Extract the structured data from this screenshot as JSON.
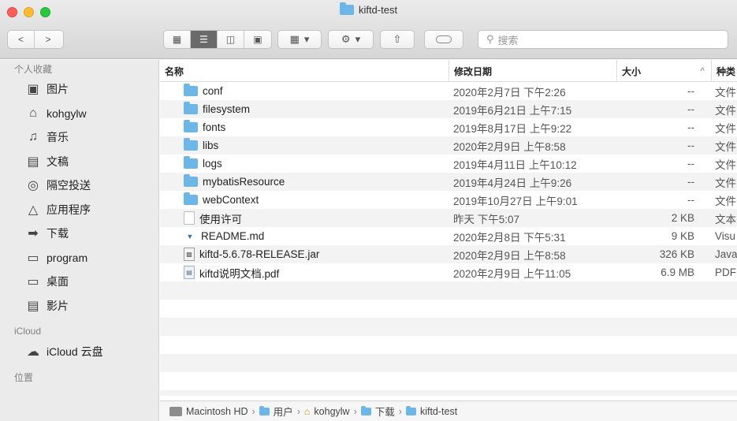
{
  "window": {
    "title": "kiftd-test"
  },
  "toolbar": {
    "nav_back": "<",
    "nav_forward": ">",
    "view_modes": [
      "icon-view",
      "list-view",
      "column-view",
      "gallery-view"
    ],
    "group_button": "▾",
    "action_button": "▾",
    "search_placeholder": "搜索"
  },
  "sidebar": {
    "sections": [
      {
        "title": "个人收藏",
        "items": [
          {
            "label": "图片",
            "icon": "camera-icon"
          },
          {
            "label": "kohgylw",
            "icon": "home-icon"
          },
          {
            "label": "音乐",
            "icon": "music-icon"
          },
          {
            "label": "文稿",
            "icon": "document-icon"
          },
          {
            "label": "隔空投送",
            "icon": "airdrop-icon"
          },
          {
            "label": "应用程序",
            "icon": "applications-icon"
          },
          {
            "label": "下载",
            "icon": "download-icon"
          },
          {
            "label": "program",
            "icon": "folder-icon"
          },
          {
            "label": "桌面",
            "icon": "desktop-icon"
          },
          {
            "label": "影片",
            "icon": "film-icon"
          }
        ]
      },
      {
        "title": "iCloud",
        "items": [
          {
            "label": "iCloud 云盘",
            "icon": "cloud-icon"
          }
        ]
      },
      {
        "title": "位置",
        "items": []
      }
    ]
  },
  "columns": {
    "name": "名称",
    "date": "修改日期",
    "size": "大小",
    "kind": "种类",
    "sort_indicator": "^"
  },
  "files": [
    {
      "name": "conf",
      "date": "2020年2月7日 下午2:26",
      "size": "--",
      "kind": "文件",
      "type": "folder"
    },
    {
      "name": "filesystem",
      "date": "2019年6月21日 上午7:15",
      "size": "--",
      "kind": "文件",
      "type": "folder"
    },
    {
      "name": "fonts",
      "date": "2019年8月17日 上午9:22",
      "size": "--",
      "kind": "文件",
      "type": "folder"
    },
    {
      "name": "libs",
      "date": "2020年2月9日 上午8:58",
      "size": "--",
      "kind": "文件",
      "type": "folder"
    },
    {
      "name": "logs",
      "date": "2019年4月11日 上午10:12",
      "size": "--",
      "kind": "文件",
      "type": "folder"
    },
    {
      "name": "mybatisResource",
      "date": "2019年4月24日 上午9:26",
      "size": "--",
      "kind": "文件",
      "type": "folder"
    },
    {
      "name": "webContext",
      "date": "2019年10月27日 上午9:01",
      "size": "--",
      "kind": "文件",
      "type": "folder"
    },
    {
      "name": "使用许可",
      "date": "昨天 下午5:07",
      "size": "2 KB",
      "kind": "文本",
      "type": "text"
    },
    {
      "name": "README.md",
      "date": "2020年2月8日 下午5:31",
      "size": "9 KB",
      "kind": "Visu",
      "type": "md"
    },
    {
      "name": "kiftd-5.6.78-RELEASE.jar",
      "date": "2020年2月9日 上午8:58",
      "size": "326 KB",
      "kind": "Java",
      "type": "jar"
    },
    {
      "name": "kiftd说明文档.pdf",
      "date": "2020年2月9日 上午11:05",
      "size": "6.9 MB",
      "kind": "PDF",
      "type": "pdf"
    }
  ],
  "pathbar": [
    "Macintosh HD",
    "用户",
    "kohgylw",
    "下载",
    "kiftd-test"
  ],
  "colors": {
    "folder": "#6cb6e8",
    "sidebar_bg": "#ecebeb",
    "row_stripe": "#f3f3f3"
  }
}
